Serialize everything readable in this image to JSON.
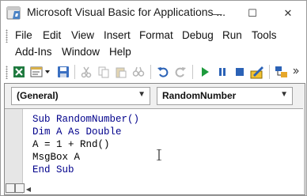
{
  "titlebar": {
    "title": "Microsoft Visual Basic for Applications ...",
    "minimize_glyph": "—",
    "maximize_glyph": "☐",
    "close_glyph": "✕"
  },
  "menu": {
    "row1": [
      {
        "label": "File"
      },
      {
        "label": "Edit"
      },
      {
        "label": "View"
      },
      {
        "label": "Insert"
      },
      {
        "label": "Format"
      },
      {
        "label": "Debug"
      },
      {
        "label": "Run"
      },
      {
        "label": "Tools"
      }
    ],
    "row2": [
      {
        "label": "Add-Ins"
      },
      {
        "label": "Window"
      },
      {
        "label": "Help"
      }
    ]
  },
  "toolbar": {
    "icons": [
      "excel-view-icon",
      "insert-module-icon",
      "dropdown-arrow-icon",
      "save-icon",
      "cut-icon",
      "copy-icon",
      "paste-icon",
      "find-icon",
      "undo-icon",
      "redo-icon",
      "run-icon",
      "break-icon",
      "reset-icon",
      "design-mode-icon",
      "project-explorer-icon"
    ]
  },
  "code_window": {
    "object_combo": "(General)",
    "procedure_combo": "RandomNumber",
    "lines": [
      "Sub RandomNumber()",
      "Dim A As Double",
      "A = 1 + Rnd()",
      "MsgBox A",
      "End Sub"
    ]
  },
  "colors": {
    "keyword": "#00008b",
    "accent_green": "#1e9a3c",
    "undo_blue": "#2b62b6"
  }
}
